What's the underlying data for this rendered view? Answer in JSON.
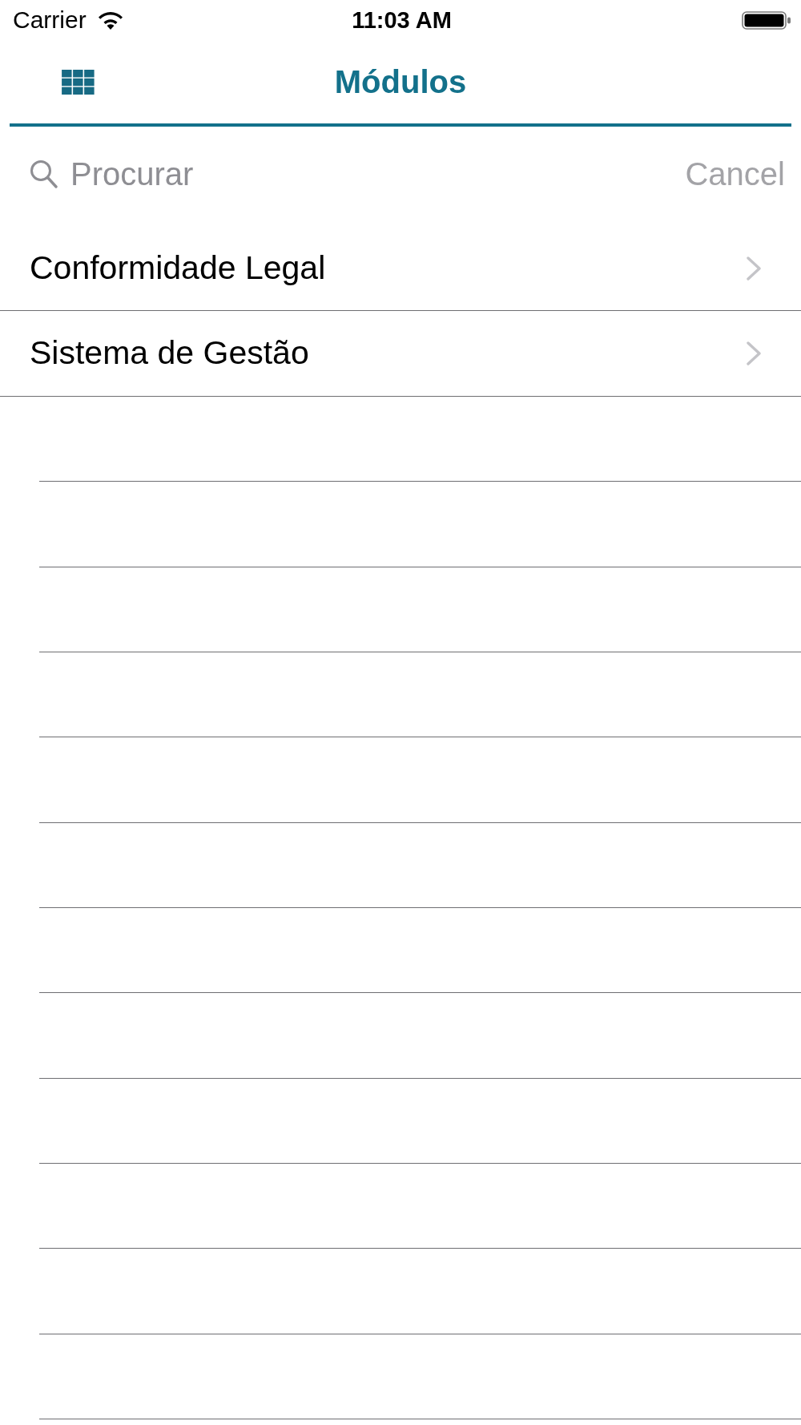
{
  "status_bar": {
    "carrier": "Carrier",
    "time": "11:03 AM"
  },
  "nav_bar": {
    "title": "Módulos"
  },
  "search": {
    "placeholder": "Procurar",
    "cancel": {
      "label": "Cancel",
      "disabled": true
    }
  },
  "list": {
    "items": [
      {
        "label": "Conformidade Legal"
      },
      {
        "label": "Sistema de Gestão"
      }
    ]
  }
}
